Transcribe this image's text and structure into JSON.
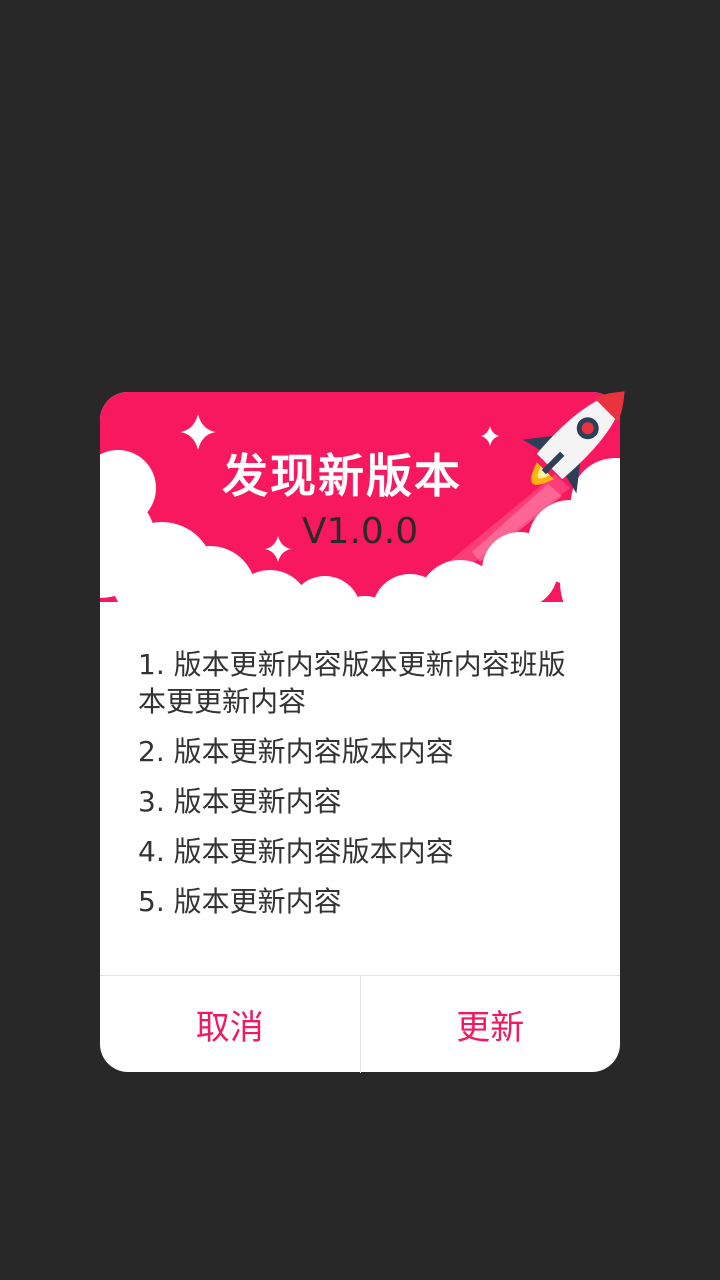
{
  "colors": {
    "backdrop": "#282828",
    "header_pink": "#f8185f",
    "accent": "#f01a63",
    "text": "#333333"
  },
  "dialog": {
    "title": "发现新版本",
    "version": "V1.0.0",
    "icons": [
      "rocket-icon",
      "sparkle-icon",
      "cloud-icon"
    ],
    "notes": [
      "1. 版本更新内容版本更新内容班版本更更新内容",
      "2. 版本更新内容版本内容",
      "3. 版本更新内容",
      "4. 版本更新内容版本内容",
      "5. 版本更新内容"
    ],
    "cancel_label": "取消",
    "update_label": "更新"
  }
}
